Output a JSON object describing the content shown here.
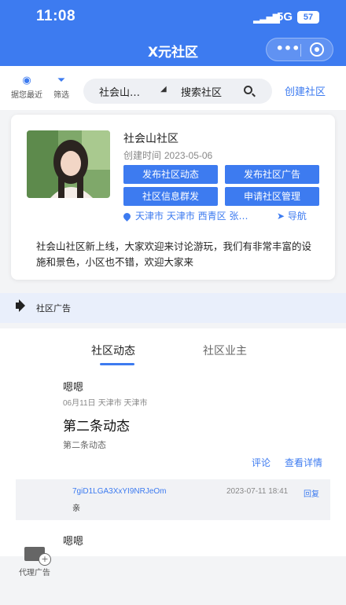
{
  "status": {
    "time": "11:08",
    "network": "5G",
    "battery": "57"
  },
  "nav": {
    "title": "X元社区",
    "more_glyph": "•••"
  },
  "topbar": {
    "nearby_label": "据您最近",
    "filter_label": "筛选",
    "community_select": "社会山…",
    "search_placeholder": "搜索社区",
    "create_label": "创建社区"
  },
  "community": {
    "name": "社会山社区",
    "created_label": "创建时间",
    "created_date": "2023-05-06",
    "actions": [
      "发布社区动态",
      "发布社区广告",
      "社区信息群发",
      "申请社区管理"
    ],
    "location": "天津市 天津市 西青区 张…",
    "nav_label": "导航",
    "description": "社会山社区新上线，大家欢迎来讨论游玩，我们有非常丰富的设施和景色，小区也不错，欢迎大家来"
  },
  "ad_bar": {
    "label": "社区广告"
  },
  "tabs": [
    {
      "label": "社区动态",
      "active": true
    },
    {
      "label": "社区业主",
      "active": false
    }
  ],
  "posts": [
    {
      "author": "嗯嗯",
      "meta_date": "06月11日",
      "meta_location": "天津市 天津市",
      "title": "第二条动态",
      "body": "第二条动态",
      "comment_label": "评论",
      "detail_label": "查看详情",
      "comment": {
        "user": "7giD1LGA3XxYI9NRJeOm",
        "time": "2023-07-11 18:41",
        "reply_label": "回复",
        "text": "亲"
      }
    },
    {
      "author": "嗯嗯"
    }
  ],
  "float_button": {
    "label": "代理广告"
  },
  "colors": {
    "primary": "#3d7bf0",
    "ad_bar_bg": "#e9effb",
    "comment_bg": "#f1f2f5"
  }
}
